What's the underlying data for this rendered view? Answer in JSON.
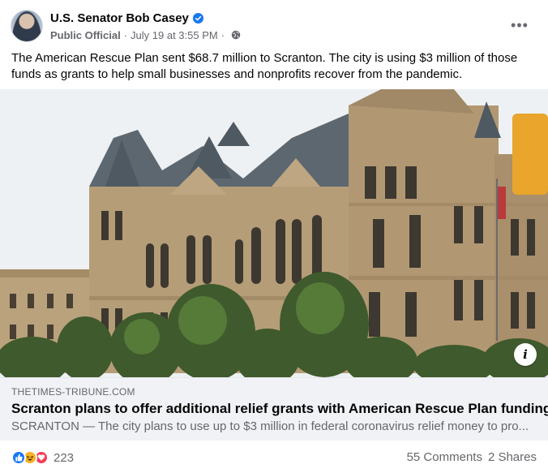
{
  "post": {
    "author": "U.S. Senator Bob Casey",
    "role": "Public Official",
    "separator": "·",
    "time": "July 19 at 3:55 PM",
    "separator2": "·",
    "more_label": "•••",
    "text": "The American Rescue Plan sent $68.7 million to Scranton. The city is using $3 million of those funds as grants to help small businesses and nonprofits recover from the pandemic."
  },
  "link_preview": {
    "domain": "THETIMES-TRIBUNE.COM",
    "title": "Scranton plans to offer additional relief grants with American Rescue Plan funding",
    "description": "SCRANTON — The city plans to use up to $3 million in federal coronavirus relief money to pro...",
    "info_label": "i"
  },
  "footer": {
    "reaction_icons": [
      "like-icon",
      "haha-icon",
      "love-icon"
    ],
    "reaction_count": "223",
    "comments": "55 Comments",
    "shares": "2 Shares"
  },
  "colors": {
    "facebook_blue": "#1877f2",
    "secondary_text": "#65676b",
    "card_background": "#f0f2f5",
    "haha_yellow": "#f7b125",
    "love_red": "#f33e58"
  }
}
